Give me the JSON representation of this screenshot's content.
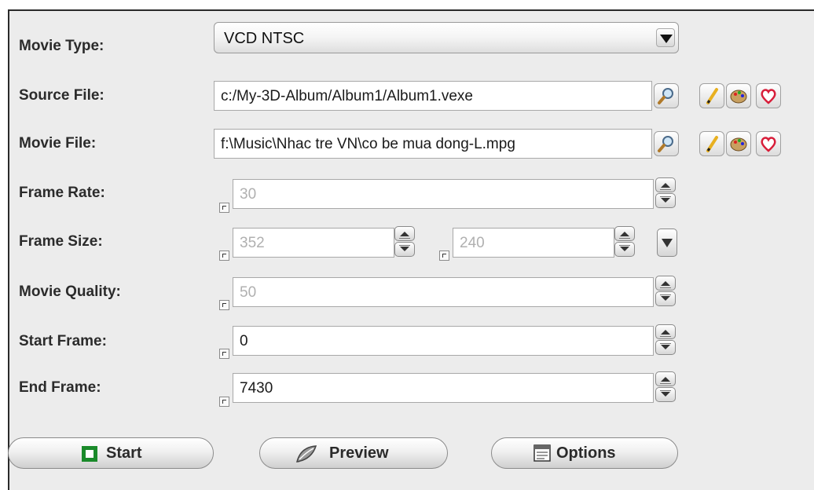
{
  "labels": {
    "movie_type": "Movie Type:",
    "source_file": "Source File:",
    "movie_file": "Movie File:",
    "frame_rate": "Frame Rate:",
    "frame_size": "Frame Size:",
    "movie_quality": "Movie Quality:",
    "start_frame": "Start Frame:",
    "end_frame": "End Frame:"
  },
  "fields": {
    "movie_type_value": "VCD NTSC",
    "source_file_value": "c:/My-3D-Album/Album1/Album1.vexe",
    "movie_file_value": "f:\\Music\\Nhac tre VN\\co be mua dong-L.mpg",
    "frame_rate_value": "30",
    "frame_width_value": "352",
    "frame_height_value": "240",
    "movie_quality_value": "50",
    "start_frame_value": "0",
    "end_frame_value": "7430"
  },
  "buttons": {
    "start": "Start",
    "preview": "Preview",
    "options": "Options"
  },
  "icons": {
    "browse": "magnifier-icon",
    "edit": "pencil-icon",
    "palette": "palette-icon",
    "favorite": "heart-icon"
  },
  "colors": {
    "panel_bg": "#ececec",
    "start_icon": "#1a8a2a",
    "heart": "#d81e3a"
  }
}
